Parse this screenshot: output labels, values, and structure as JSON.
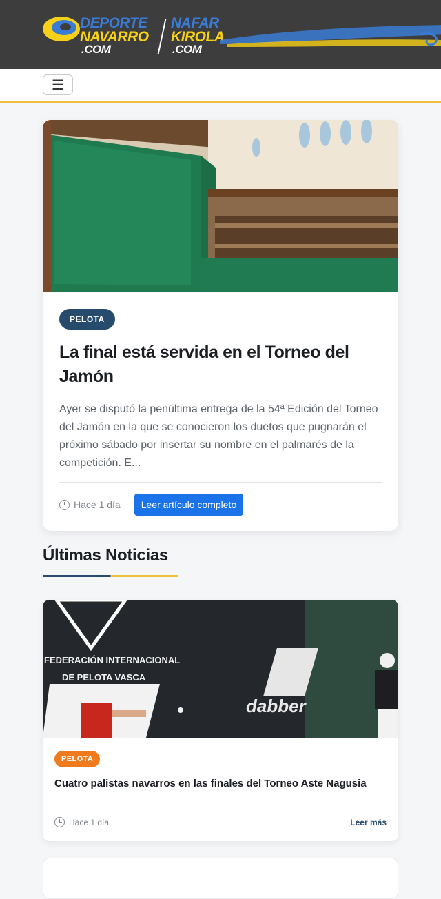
{
  "header": {
    "logo": {
      "line1_left": "DEPORTE",
      "line2_left": "NAVARRO",
      "line3_left": ".COM",
      "line1_right": "NAFAR",
      "line2_right": "KIROLA",
      "line3_right": ".COM"
    },
    "menu_icon": "☰"
  },
  "colors": {
    "topbar": "#3d3d3d",
    "accent_yellow": "#f0c040",
    "navy": "#274b6d",
    "blue_button": "#1a73e8",
    "orange_badge": "#f07b1f"
  },
  "featured": {
    "category": "PELOTA",
    "title": "La final está servida en el Torneo del Jamón",
    "excerpt": "Ayer se disputó la penúltima entrega de la 54ª Edición del Torneo del Jamón en la que se conocieron los duetos que pugnarán el próximo sábado por insertar su nombre en el palmarés de la competición. E...",
    "time": "Hace 1 día",
    "read_button": "Leer artículo completo"
  },
  "latest": {
    "section_title": "Últimas Noticias",
    "items": [
      {
        "category": "PELOTA",
        "title": "Cuatro palistas navarros en las finales del Torneo Aste Nagusia",
        "time": "Hace 1 día",
        "more": "Leer más",
        "image_text": {
          "federation_line1": "FEDERACIÓN INTERNACIONAL",
          "federation_line2": "DE PELOTA VASCA",
          "brand": "dabber"
        }
      }
    ]
  }
}
